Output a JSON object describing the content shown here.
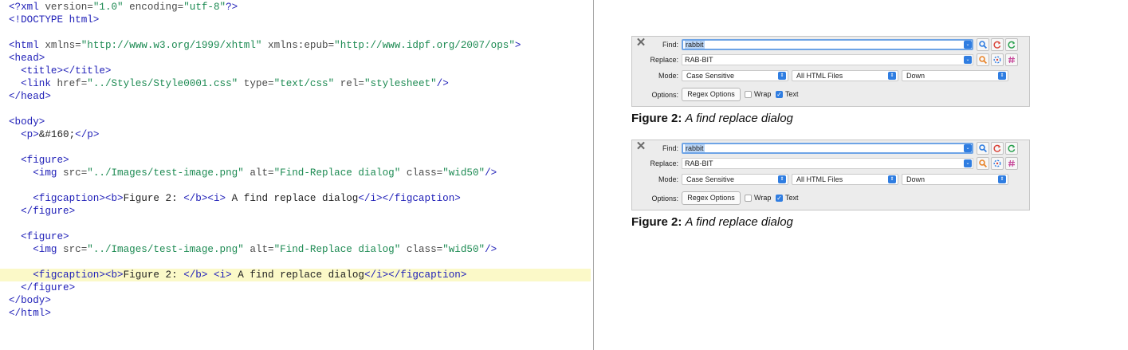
{
  "code_lines": [
    [
      [
        "tag",
        "<?xml "
      ],
      [
        "attr",
        "version="
      ],
      [
        "val",
        "\"1.0\""
      ],
      [
        "attr",
        " encoding="
      ],
      [
        "val",
        "\"utf-8\""
      ],
      [
        "tag",
        "?>"
      ]
    ],
    [
      [
        "tag",
        "<!DOCTYPE html>"
      ]
    ],
    [],
    [
      [
        "tag",
        "<html "
      ],
      [
        "attr",
        "xmlns="
      ],
      [
        "val",
        "\"http://www.w3.org/1999/xhtml\""
      ],
      [
        "attr",
        " xmlns:epub="
      ],
      [
        "val",
        "\"http://www.idpf.org/2007/ops\""
      ],
      [
        "tag",
        ">"
      ]
    ],
    [
      [
        "tag",
        "<head>"
      ]
    ],
    [
      [
        "txt",
        "  "
      ],
      [
        "tag",
        "<title></title>"
      ]
    ],
    [
      [
        "txt",
        "  "
      ],
      [
        "tag",
        "<link "
      ],
      [
        "attr",
        "href="
      ],
      [
        "val",
        "\"../Styles/Style0001.css\""
      ],
      [
        "attr",
        " type="
      ],
      [
        "val",
        "\"text/css\""
      ],
      [
        "attr",
        " rel="
      ],
      [
        "val",
        "\"stylesheet\""
      ],
      [
        "tag",
        "/>"
      ]
    ],
    [
      [
        "tag",
        "</head>"
      ]
    ],
    [],
    [
      [
        "tag",
        "<body>"
      ]
    ],
    [
      [
        "txt",
        "  "
      ],
      [
        "tag",
        "<p>"
      ],
      [
        "txt",
        "&#160;"
      ],
      [
        "tag",
        "</p>"
      ]
    ],
    [],
    [
      [
        "txt",
        "  "
      ],
      [
        "tag",
        "<figure>"
      ]
    ],
    [
      [
        "txt",
        "    "
      ],
      [
        "tag",
        "<img "
      ],
      [
        "attr",
        "src="
      ],
      [
        "val",
        "\"../Images/test-image.png\""
      ],
      [
        "attr",
        " alt="
      ],
      [
        "val",
        "\"Find-Replace dialog\""
      ],
      [
        "attr",
        " class="
      ],
      [
        "val",
        "\"wid50\""
      ],
      [
        "tag",
        "/>"
      ]
    ],
    [],
    [
      [
        "txt",
        "    "
      ],
      [
        "tag",
        "<figcaption><b>"
      ],
      [
        "txt",
        "Figure 2: "
      ],
      [
        "tag",
        "</b><i>"
      ],
      [
        "txt",
        " A find replace dialog"
      ],
      [
        "tag",
        "</i></figcaption>"
      ]
    ],
    [
      [
        "txt",
        "  "
      ],
      [
        "tag",
        "</figure>"
      ]
    ],
    [],
    [
      [
        "txt",
        "  "
      ],
      [
        "tag",
        "<figure>"
      ]
    ],
    [
      [
        "txt",
        "    "
      ],
      [
        "tag",
        "<img "
      ],
      [
        "attr",
        "src="
      ],
      [
        "val",
        "\"../Images/test-image.png\""
      ],
      [
        "attr",
        " alt="
      ],
      [
        "val",
        "\"Find-Replace dialog\""
      ],
      [
        "attr",
        " class="
      ],
      [
        "val",
        "\"wid50\""
      ],
      [
        "tag",
        "/>"
      ]
    ],
    [],
    [
      [
        "txt",
        "    "
      ],
      [
        "tag",
        "<figcaption><b>"
      ],
      [
        "txt",
        "Figure 2: "
      ],
      [
        "tag",
        "</b>"
      ],
      [
        "txt",
        " "
      ],
      [
        "tag",
        "<i>"
      ],
      [
        "txt",
        " A find replace dialog"
      ],
      [
        "tag",
        "</i></figcaption>"
      ]
    ],
    [
      [
        "txt",
        "  "
      ],
      [
        "tag",
        "</figure>"
      ]
    ],
    [
      [
        "tag",
        "</body>"
      ]
    ],
    [
      [
        "tag",
        "</html>"
      ]
    ]
  ],
  "highlighted_line": 21,
  "colors": {
    "tag": "#2020b8",
    "attribute": "#4a4a4a",
    "value": "#1c8a52",
    "highlight": "#fbf9c8",
    "accent": "#2f7de1"
  },
  "preview": {
    "figures": [
      {
        "dialog": {
          "find_label": "Find:",
          "find_value": "rabbit",
          "replace_label": "Replace:",
          "replace_value": "RAB-BIT",
          "mode_label": "Mode:",
          "mode_value": "Case Sensitive",
          "scope_value": "All HTML Files",
          "direction_value": "Down",
          "options_label": "Options:",
          "regex_button": "Regex Options",
          "wrap_label": "Wrap",
          "wrap_checked": false,
          "text_label": "Text",
          "text_checked": true
        },
        "caption_bold": "Figure 2:",
        "caption_italic": "A find replace dialog"
      },
      {
        "dialog": {
          "find_label": "Find:",
          "find_value": "rabbit",
          "replace_label": "Replace:",
          "replace_value": "RAB-BIT",
          "mode_label": "Mode:",
          "mode_value": "Case Sensitive",
          "scope_value": "All HTML Files",
          "direction_value": "Down",
          "options_label": "Options:",
          "regex_button": "Regex Options",
          "wrap_label": "Wrap",
          "wrap_checked": false,
          "text_label": "Text",
          "text_checked": true
        },
        "caption_bold": "Figure 2:",
        "caption_italic": "A find replace dialog"
      }
    ]
  },
  "icons": {
    "close": "close-icon",
    "find_next": "search-icon",
    "replace": "replace-icon",
    "replace_all": "refresh-icon",
    "replace_current": "search-replace-icon",
    "count": "count-icon",
    "count_all": "hash-icon"
  }
}
